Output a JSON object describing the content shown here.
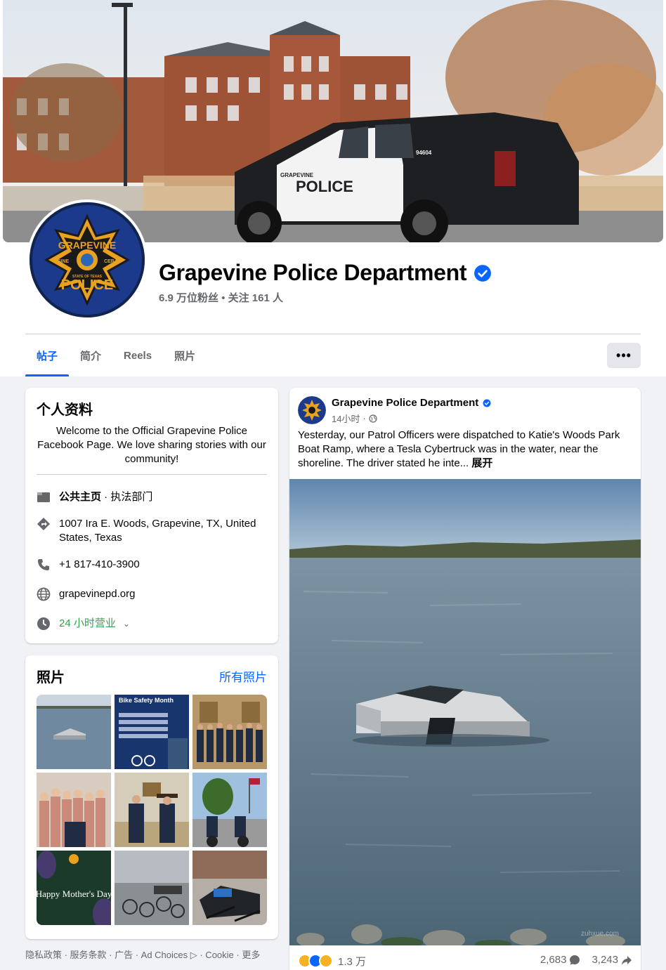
{
  "page": {
    "name": "Grapevine Police Department",
    "followers_line": "6.9 万位粉丝",
    "following_line": "关注 161 人",
    "separator": " • "
  },
  "cover": {
    "vehicle_text": "POLICE",
    "vehicle_number": "94604",
    "vehicle_brand": "GRAPEVINE"
  },
  "tabs": [
    {
      "label": "帖子",
      "active": true
    },
    {
      "label": "简介",
      "active": false
    },
    {
      "label": "Reels",
      "active": false
    },
    {
      "label": "照片",
      "active": false
    }
  ],
  "more_label": "•••",
  "intro": {
    "title": "个人资料",
    "bio": "Welcome to the Official Grapevine Police Facebook Page. We love sharing stories with our community!",
    "category_label": "公共主页",
    "category_value": " · 执法部门",
    "address": "1007 Ira E. Woods, Grapevine, TX, United States, Texas",
    "phone": "+1 817-410-3900",
    "website": "grapevinepd.org",
    "hours": "24 小时营业"
  },
  "photos": {
    "title": "照片",
    "all_link": "所有照片",
    "tiles": [
      {
        "name": "photo-cybertruck",
        "caption": ""
      },
      {
        "name": "photo-bike-safety",
        "caption": "Bike Safety Month"
      },
      {
        "name": "photo-officers-group",
        "caption": ""
      },
      {
        "name": "photo-community-group",
        "caption": ""
      },
      {
        "name": "photo-officers-cowboy",
        "caption": ""
      },
      {
        "name": "photo-motorcycle-officers",
        "caption": ""
      },
      {
        "name": "photo-mothers-day",
        "caption": "Happy Mother's Day"
      },
      {
        "name": "photo-bikes-storage",
        "caption": ""
      },
      {
        "name": "photo-scooters-storage",
        "caption": ""
      }
    ]
  },
  "footer": {
    "links": "隐私政策 · 服务条款 · 广告 · Ad Choices ▷ · Cookie · 更多"
  },
  "post": {
    "author": "Grapevine Police Department",
    "time": "14小时",
    "text": "Yesterday, our Patrol Officers were dispatched to Katie's Woods Park Boat Ramp, where a Tesla Cybertruck was in the water, near the shoreline. The driver stated he inte... ",
    "see_more": "展开",
    "reaction_count": "1.3 万",
    "comments": "2,683",
    "shares": "3,243",
    "watermark": "zuhxue.com"
  },
  "badge": {
    "top": "GRAPEVINE",
    "left": "SINE",
    "right": "CERA",
    "middle": "STATE OF TEXAS",
    "bottom": "POLICE"
  },
  "colors": {
    "accent": "#0866ff",
    "secondary_text": "#65676b",
    "open_green": "#31a24c",
    "badge_navy": "#1b3a8c",
    "badge_gold": "#e8a21f"
  },
  "icons": {
    "verified": "verified-badge-icon",
    "category": "flag-icon",
    "address": "directions-icon",
    "phone": "phone-icon",
    "website": "globe-icon",
    "hours": "clock-icon",
    "privacy": "globe-small-icon"
  }
}
